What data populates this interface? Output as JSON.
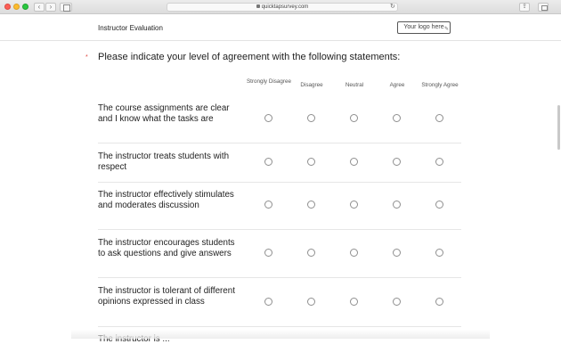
{
  "browser": {
    "url": "quicktapsurvey.com"
  },
  "header": {
    "title": "Instructor Evaluation",
    "logo_placeholder": "Your logo here"
  },
  "question": {
    "required_mark": "*",
    "text": "Please indicate your level of agreement with the following statements:",
    "columns": [
      "Strongly Disagree",
      "Disagree",
      "Neutral",
      "Agree",
      "Strongly Agree"
    ],
    "rows": [
      "The course assignments are clear and I know what the tasks are",
      "The instructor treats students with respect",
      "The instructor effectively stimulates and moderates discussion",
      "The instructor encourages students to ask questions and give answers",
      "The instructor is tolerant of different opinions expressed in class"
    ],
    "partial_row": "The instructor is ..."
  }
}
